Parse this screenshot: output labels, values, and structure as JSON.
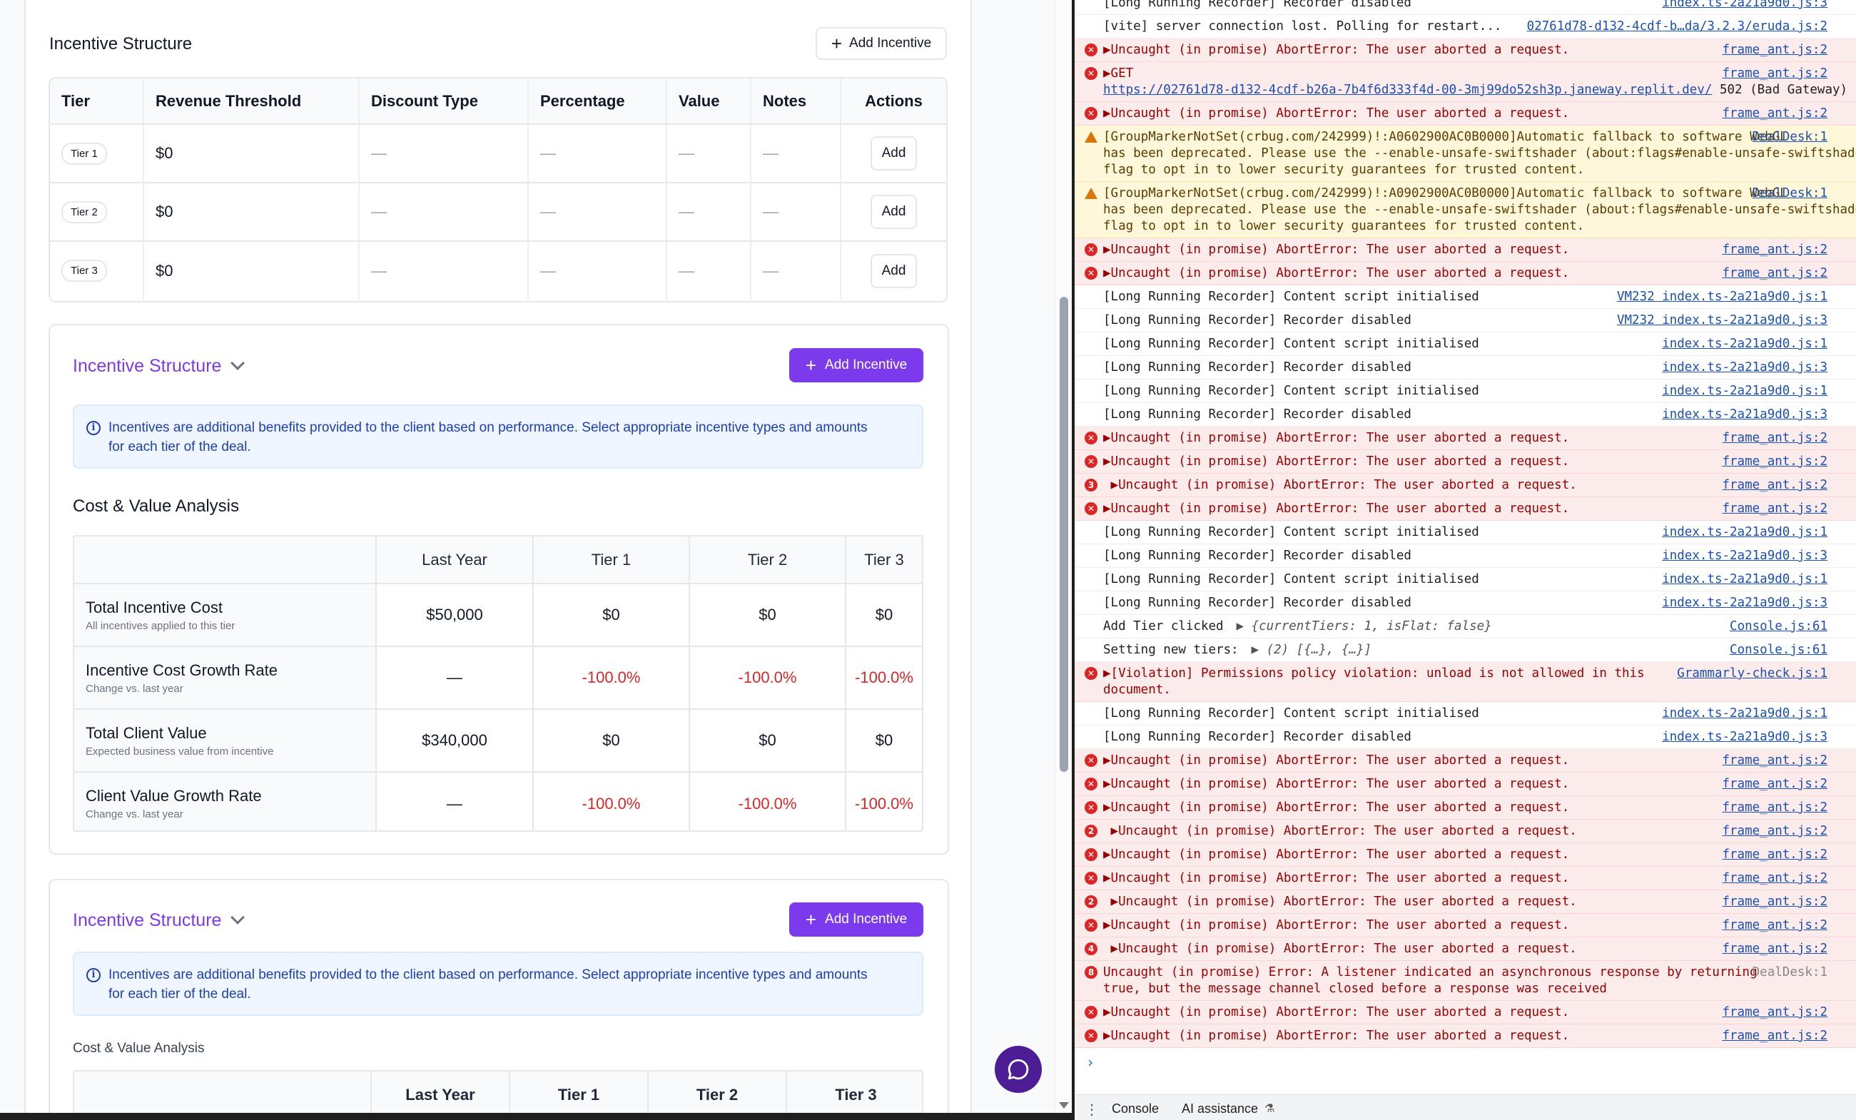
{
  "colors": {
    "accent": "#7c3aed",
    "danger": "#dc2626",
    "info_bg": "#eff6ff",
    "info_text": "#1e40af"
  },
  "section1": {
    "title": "Incentive Structure",
    "add_button": "Add Incentive",
    "headers": [
      "Tier",
      "Revenue Threshold",
      "Discount Type",
      "Percentage",
      "Value",
      "Notes",
      "Actions"
    ],
    "rows": [
      {
        "tier": "Tier 1",
        "threshold": "$0",
        "discount": "—",
        "percentage": "—",
        "value": "—",
        "notes": "—",
        "action": "Add"
      },
      {
        "tier": "Tier 2",
        "threshold": "$0",
        "discount": "—",
        "percentage": "—",
        "value": "—",
        "notes": "—",
        "action": "Add"
      },
      {
        "tier": "Tier 3",
        "threshold": "$0",
        "discount": "—",
        "percentage": "—",
        "value": "—",
        "notes": "—",
        "action": "Add"
      }
    ]
  },
  "section2": {
    "title": "Incentive Structure",
    "add_button": "Add Incentive",
    "info": "Incentives are additional benefits provided to the client based on performance. Select appropriate incentive types and amounts for each tier of the deal.",
    "analysis_title": "Cost & Value Analysis",
    "headers": [
      "",
      "Last Year",
      "Tier 1",
      "Tier 2",
      "Tier 3"
    ],
    "rows": [
      {
        "label": "Total Incentive Cost",
        "sub": "All incentives applied to this tier",
        "last_year": "$50,000",
        "t1": "$0",
        "t2": "$0",
        "t3": "$0",
        "negative": false
      },
      {
        "label": "Incentive Cost Growth Rate",
        "sub": "Change vs. last year",
        "last_year": "—",
        "t1": "-100.0%",
        "t2": "-100.0%",
        "t3": "-100.0%",
        "negative": true
      },
      {
        "label": "Total Client Value",
        "sub": "Expected business value from incentive",
        "last_year": "$340,000",
        "t1": "$0",
        "t2": "$0",
        "t3": "$0",
        "negative": false
      },
      {
        "label": "Client Value Growth Rate",
        "sub": "Change vs. last year",
        "last_year": "—",
        "t1": "-100.0%",
        "t2": "-100.0%",
        "t3": "-100.0%",
        "negative": true
      }
    ]
  },
  "section3": {
    "title": "Incentive Structure",
    "add_button": "Add Incentive",
    "info": "Incentives are additional benefits provided to the client based on performance. Select appropriate incentive types and amounts for each tier of the deal.",
    "analysis_title": "Cost & Value Analysis",
    "headers": [
      "",
      "Last Year",
      "Tier 1",
      "Tier 2",
      "Tier 3"
    ]
  },
  "console": {
    "lines": [
      {
        "type": "log",
        "text": "[Long Running Recorder] Recorder disabled",
        "src": "index.ts-2a21a9d0.js:3"
      },
      {
        "type": "log",
        "text": "[vite] server connection lost. Polling for restart...",
        "src": "02761d78-d132-4cdf-b…da/3.2.3/eruda.js:2"
      },
      {
        "type": "err",
        "text": "▶Uncaught (in promise) AbortError: The user aborted a request.",
        "src": "frame_ant.js:2"
      },
      {
        "type": "err2",
        "text": "▶GET",
        "src": "frame_ant.js:2",
        "text2": "https://02761d78-d132-4cdf-b26a-7b4f6d333f4d-00-3mj99do52sh3p.janeway.replit.dev/",
        "text3": " 502 (Bad Gateway)"
      },
      {
        "type": "err",
        "text": "▶Uncaught (in promise) AbortError: The user aborted a request.",
        "src": "frame_ant.js:2"
      },
      {
        "type": "warn",
        "text": "[GroupMarkerNotSet(crbug.com/242999)!:A0602900AC0B0000]Automatic fallback to software WebGL\nhas been deprecated. Please use the --enable-unsafe-swiftshader (about:flags#enable-unsafe-swiftshader)\nflag to opt in to lower security guarantees for trusted content.",
        "src": "DealDesk:1"
      },
      {
        "type": "warn",
        "text": "[GroupMarkerNotSet(crbug.com/242999)!:A0902900AC0B0000]Automatic fallback to software WebGL\nhas been deprecated. Please use the --enable-unsafe-swiftshader (about:flags#enable-unsafe-swiftshader)\nflag to opt in to lower security guarantees for trusted content.",
        "src": "DealDesk:1"
      },
      {
        "type": "err",
        "text": "▶Uncaught (in promise) AbortError: The user aborted a request.",
        "src": "frame_ant.js:2"
      },
      {
        "type": "err",
        "text": "▶Uncaught (in promise) AbortError: The user aborted a request.",
        "src": "frame_ant.js:2"
      },
      {
        "type": "log",
        "text": "[Long Running Recorder] Content script initialised",
        "src": "VM232 index.ts-2a21a9d0.js:1"
      },
      {
        "type": "log",
        "text": "[Long Running Recorder] Recorder disabled",
        "src": "VM232 index.ts-2a21a9d0.js:3"
      },
      {
        "type": "log",
        "text": "[Long Running Recorder] Content script initialised",
        "src": "index.ts-2a21a9d0.js:1"
      },
      {
        "type": "log",
        "text": "[Long Running Recorder] Recorder disabled",
        "src": "index.ts-2a21a9d0.js:3"
      },
      {
        "type": "log",
        "text": "[Long Running Recorder] Content script initialised",
        "src": "index.ts-2a21a9d0.js:1"
      },
      {
        "type": "log",
        "text": "[Long Running Recorder] Recorder disabled",
        "src": "index.ts-2a21a9d0.js:3"
      },
      {
        "type": "err",
        "text": "▶Uncaught (in promise) AbortError: The user aborted a request.",
        "src": "frame_ant.js:2"
      },
      {
        "type": "err",
        "text": "▶Uncaught (in promise) AbortError: The user aborted a request.",
        "src": "frame_ant.js:2"
      },
      {
        "type": "err",
        "count": "3",
        "text": " ▶Uncaught (in promise) AbortError: The user aborted a request.",
        "src": "frame_ant.js:2"
      },
      {
        "type": "err",
        "text": "▶Uncaught (in promise) AbortError: The user aborted a request.",
        "src": "frame_ant.js:2"
      },
      {
        "type": "log",
        "text": "[Long Running Recorder] Content script initialised",
        "src": "index.ts-2a21a9d0.js:1"
      },
      {
        "type": "log",
        "text": "[Long Running Recorder] Recorder disabled",
        "src": "index.ts-2a21a9d0.js:3"
      },
      {
        "type": "log",
        "text": "[Long Running Recorder] Content script initialised",
        "src": "index.ts-2a21a9d0.js:1"
      },
      {
        "type": "log",
        "text": "[Long Running Recorder] Recorder disabled",
        "src": "index.ts-2a21a9d0.js:3"
      },
      {
        "type": "obj",
        "text": "Add Tier clicked ",
        "obj": "▶ {currentTiers: 1, isFlat: false}",
        "src": "Console.js:61"
      },
      {
        "type": "obj",
        "text": "Setting new tiers: ",
        "obj": "▶ (2) [{…}, {…}]",
        "src": "Console.js:61"
      },
      {
        "type": "err",
        "text": "▶[Violation] Permissions policy violation: unload is not allowed in this\ndocument.",
        "src": "Grammarly-check.js:1"
      },
      {
        "type": "log",
        "text": "[Long Running Recorder] Content script initialised",
        "src": "index.ts-2a21a9d0.js:1"
      },
      {
        "type": "log",
        "text": "[Long Running Recorder] Recorder disabled",
        "src": "index.ts-2a21a9d0.js:3"
      },
      {
        "type": "err",
        "text": "▶Uncaught (in promise) AbortError: The user aborted a request.",
        "src": "frame_ant.js:2"
      },
      {
        "type": "err",
        "text": "▶Uncaught (in promise) AbortError: The user aborted a request.",
        "src": "frame_ant.js:2"
      },
      {
        "type": "err",
        "text": "▶Uncaught (in promise) AbortError: The user aborted a request.",
        "src": "frame_ant.js:2"
      },
      {
        "type": "err",
        "count": "2",
        "text": " ▶Uncaught (in promise) AbortError: The user aborted a request.",
        "src": "frame_ant.js:2"
      },
      {
        "type": "err",
        "text": "▶Uncaught (in promise) AbortError: The user aborted a request.",
        "src": "frame_ant.js:2"
      },
      {
        "type": "err",
        "text": "▶Uncaught (in promise) AbortError: The user aborted a request.",
        "src": "frame_ant.js:2"
      },
      {
        "type": "err",
        "count": "2",
        "text": " ▶Uncaught (in promise) AbortError: The user aborted a request.",
        "src": "frame_ant.js:2"
      },
      {
        "type": "err",
        "text": "▶Uncaught (in promise) AbortError: The user aborted a request.",
        "src": "frame_ant.js:2"
      },
      {
        "type": "err",
        "count": "4",
        "text": " ▶Uncaught (in promise) AbortError: The user aborted a request.",
        "src": "frame_ant.js:2"
      },
      {
        "type": "err",
        "count": "8",
        "plainsrc": true,
        "text": "Uncaught (in promise) Error: A listener indicated an asynchronous response by returning\ntrue, but the message channel closed before a response was received",
        "src": "DealDesk:1"
      },
      {
        "type": "err",
        "text": "▶Uncaught (in promise) AbortError: The user aborted a request.",
        "src": "frame_ant.js:2"
      },
      {
        "type": "err",
        "text": "▶Uncaught (in promise) AbortError: The user aborted a request.",
        "src": "frame_ant.js:2"
      }
    ],
    "prompt": "›",
    "tabs": [
      "Console",
      "AI assistance"
    ]
  }
}
